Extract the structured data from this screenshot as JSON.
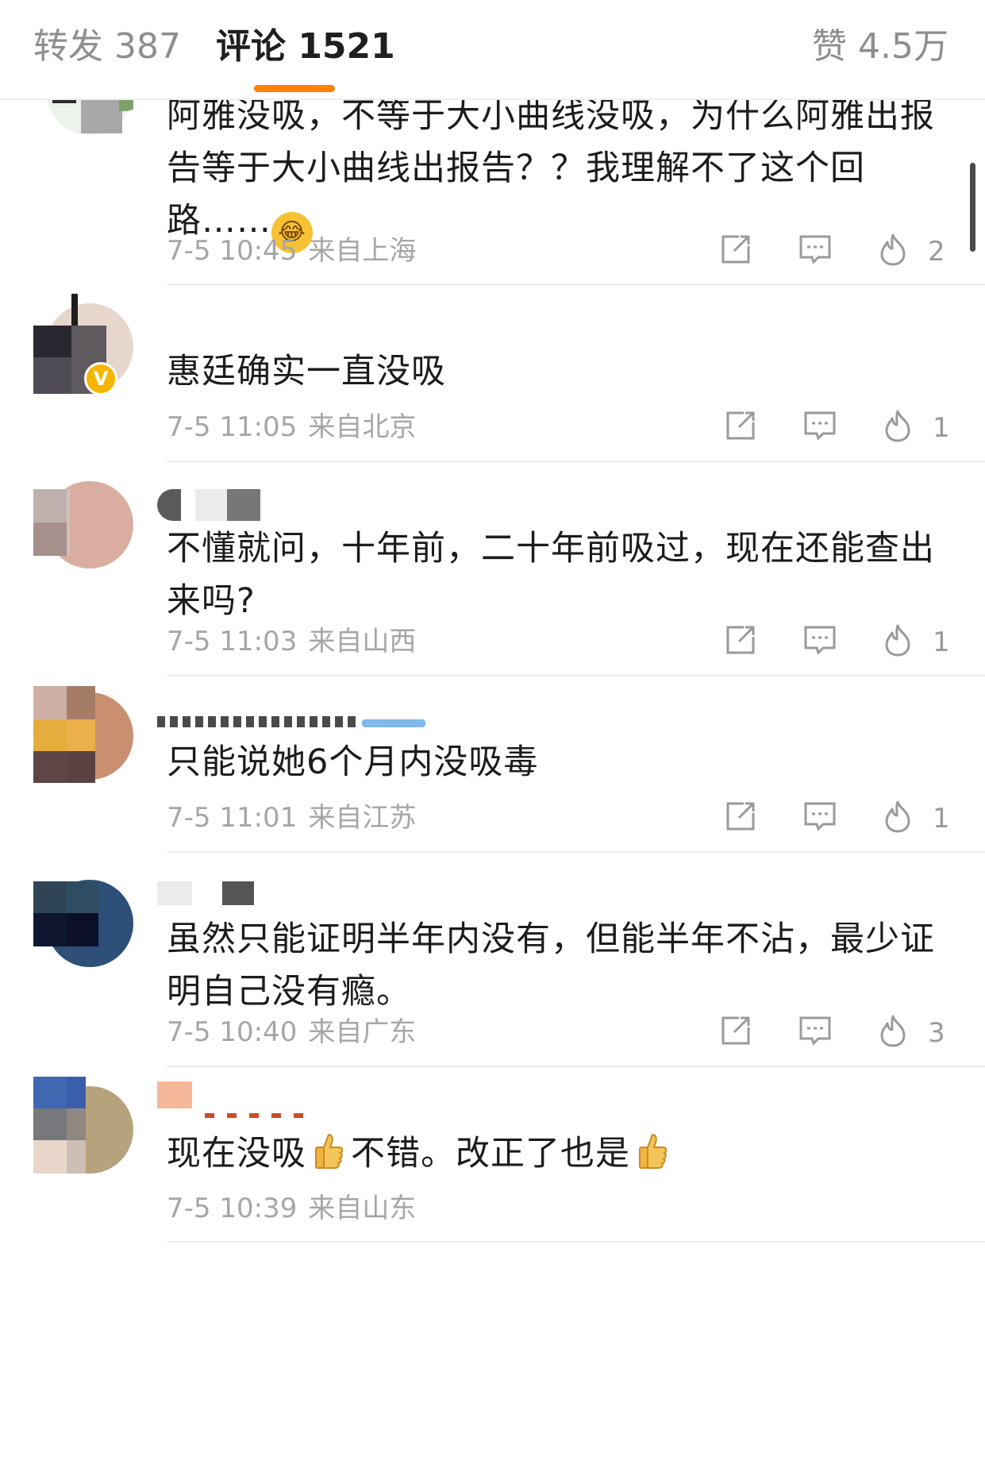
{
  "tabs": {
    "repost": "转发 387",
    "comments": "评论 1521",
    "likes": "赞 4.5万"
  },
  "comments": [
    {
      "text": "阿雅没吸，不等于大小曲线没吸，为什么阿雅出报告等于大小曲线出报告？？我理解不了这个回路……",
      "emoji": "laughing-tears",
      "time": "7-5 10:45",
      "location": "来自上海",
      "likes": "2"
    },
    {
      "text": "惠廷确实一直没吸",
      "time": "7-5 11:05",
      "location": "来自北京",
      "likes": "1",
      "verified": true
    },
    {
      "text": "不懂就问，十年前，二十年前吸过，现在还能查出来吗?",
      "time": "7-5 11:03",
      "location": "来自山西",
      "likes": "1"
    },
    {
      "text": "只能说她6个月内没吸毒",
      "time": "7-5 11:01",
      "location": "来自江苏",
      "likes": "1"
    },
    {
      "text": "虽然只能证明半年内没有，但能半年不沾，最少证明自己没有瘾。",
      "time": "7-5 10:40",
      "location": "来自广东",
      "likes": "3"
    },
    {
      "text_a": "现在没吸",
      "text_b": "不错。改正了也是",
      "emoji": "thumbs-up",
      "time": "7-5 10:39",
      "location": "来自山东"
    }
  ],
  "icons": {
    "share": "share-icon",
    "reply": "reply-icon",
    "like": "flame-icon"
  },
  "colors": {
    "accent": "#ff8200",
    "meta": "#a6a6a6",
    "verified": "#f7b500"
  }
}
